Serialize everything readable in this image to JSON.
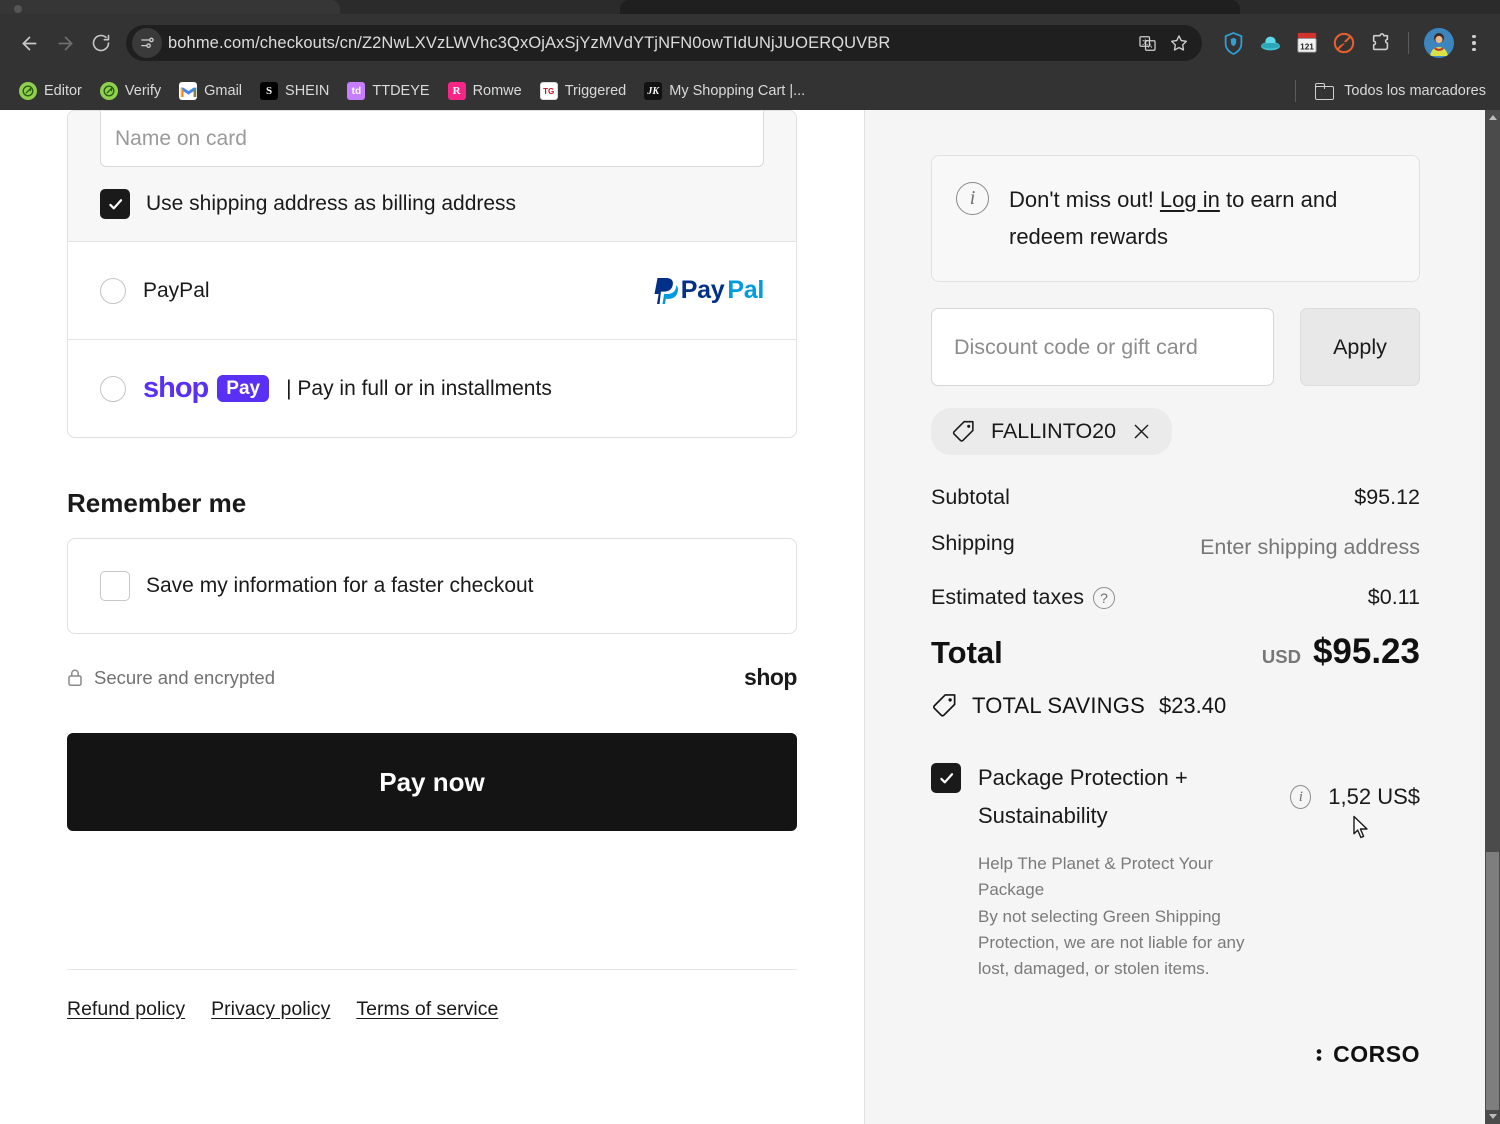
{
  "browser": {
    "url": "bohme.com/checkouts/cn/Z2NwLXVzLWVhc3QxOjAxSjYzMVdYTjNFN0owTIdUNjJUOERQUVBR",
    "back_icon": "back-arrow-icon",
    "forward_icon": "forward-arrow-icon",
    "reload_icon": "reload-icon",
    "site_info_icon": "site-settings-icon",
    "translate_icon": "translate-icon",
    "bookmark_star_icon": "bookmark-star-icon",
    "extensions": [
      {
        "name": "zenmate-vpn-extension",
        "glyph": "◈",
        "color": "#2f9fd6"
      },
      {
        "name": "browsec-extension",
        "glyph": "▲",
        "color": "#3fc3d4"
      },
      {
        "name": "calendar-extension",
        "badge": "121",
        "color": "#d0342c"
      },
      {
        "name": "adblock-extension",
        "glyph": "⊘",
        "color": "#e8602c"
      },
      {
        "name": "extensions-puzzle-icon",
        "glyph": "❖",
        "color": "#cfcfcf"
      }
    ],
    "profile_icon": "profile-avatar",
    "menu_icon": "chrome-menu-icon",
    "bookmarks": [
      {
        "label": "Editor",
        "favicon": "E",
        "bg": "#8fd14f",
        "fg": "#ffffff"
      },
      {
        "label": "Verify",
        "favicon": "V",
        "bg": "#8fd14f",
        "fg": "#ffffff"
      },
      {
        "label": "Gmail",
        "favicon": "M",
        "bg": "#ffffff",
        "fg": "#ea4335"
      },
      {
        "label": "SHEIN",
        "favicon": "S",
        "bg": "#000000",
        "fg": "#ffffff"
      },
      {
        "label": "TTDEYE",
        "favicon": "td",
        "bg": "#c77dff",
        "fg": "#ffffff"
      },
      {
        "label": "Romwe",
        "favicon": "R",
        "bg": "#f72585",
        "fg": "#ffffff"
      },
      {
        "label": "Triggered",
        "favicon": "TG",
        "bg": "#ffffff",
        "fg": "#c1121f"
      },
      {
        "label": "My Shopping Cart |...",
        "favicon": "JK",
        "bg": "#111111",
        "fg": "#ffffff"
      }
    ],
    "all_bookmarks_label": "Todos los marcadores",
    "all_bookmarks_icon": "folder-icon"
  },
  "checkout": {
    "name_on_card_placeholder": "Name on card",
    "billing_checkbox_label": "Use shipping address as billing address",
    "billing_checkbox_checked": true,
    "payment_methods": [
      {
        "id": "paypal",
        "label": "PayPal",
        "selected": false,
        "logo": "paypal-logo"
      },
      {
        "id": "shop-pay",
        "label": "| Pay in full or in installments",
        "selected": false,
        "logo": "shop-pay-logo",
        "logo_word": "shop",
        "logo_pill": "Pay"
      }
    ],
    "remember_me_heading": "Remember me",
    "save_info_label": "Save my information for a faster checkout",
    "save_info_checked": false,
    "secure_text": "Secure and encrypted",
    "secure_icon": "lock-icon",
    "shop_logo_text": "shop",
    "pay_now_label": "Pay now",
    "legal_links": [
      "Refund policy",
      "Privacy policy",
      "Terms of service"
    ]
  },
  "summary": {
    "login_banner": {
      "icon": "info-icon",
      "prefix": "Don't miss out! ",
      "link": "Log in",
      "suffix": " to earn and redeem rewards"
    },
    "discount_placeholder": "Discount code or gift card",
    "discount_value": "",
    "apply_label": "Apply",
    "applied_code": "FALLINTO20",
    "applied_code_icon": "tag-icon",
    "applied_code_remove_icon": "close-icon",
    "rows": [
      {
        "label": "Subtotal",
        "value": "$95.12",
        "muted": false,
        "help": false
      },
      {
        "label": "Shipping",
        "value": "Enter shipping address",
        "muted": true,
        "help": false
      },
      {
        "label": "Estimated taxes",
        "value": "$0.11",
        "muted": false,
        "help": true
      }
    ],
    "total_label": "Total",
    "total_currency": "USD",
    "total_value": "$95.23",
    "savings_icon": "tag-icon",
    "savings_label": "TOTAL SAVINGS",
    "savings_value": "$23.40",
    "package_protection": {
      "checked": true,
      "title": "Package Protection + Sustainability",
      "price": "1,52 US$",
      "info_icon": "info-icon",
      "desc_line1": "Help The Planet & Protect Your Package",
      "desc_line2": "By not selecting Green Shipping Protection, we are not liable for any lost, damaged, or stolen items.",
      "brand": "CORSO"
    }
  },
  "colors": {
    "accent_dark": "#141414",
    "shop_purple": "#5a31f4",
    "paypal_dark": "#003087",
    "paypal_light": "#009cde",
    "sidebar_bg": "#f5f5f5"
  }
}
